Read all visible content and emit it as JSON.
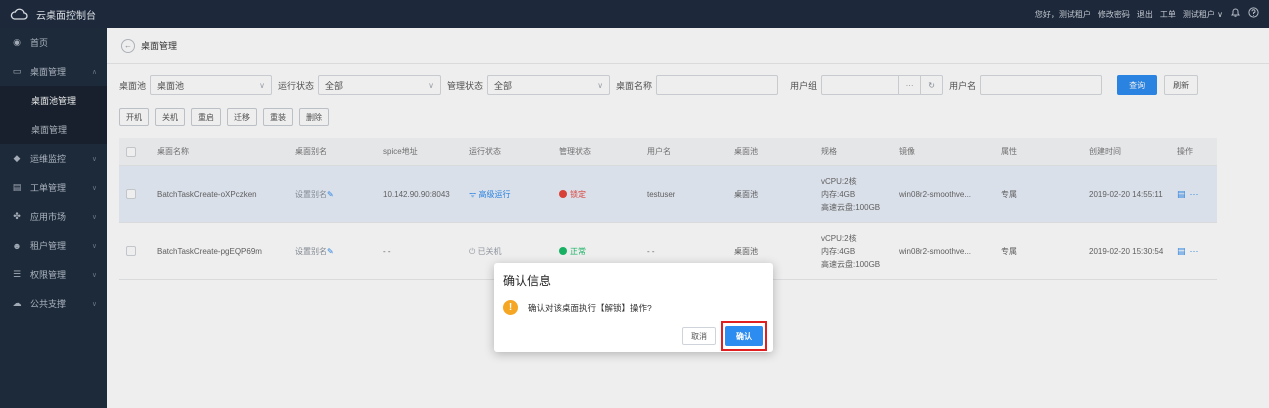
{
  "app": {
    "title": "云桌面控制台"
  },
  "topbar": {
    "greeting": "您好，测试租户",
    "change_password": "修改密码",
    "logout": "退出",
    "ticket": "工单",
    "tenant": "测试租户",
    "tenant_caret": "∨",
    "bell_icon": "bell-icon",
    "help_icon": "help-icon"
  },
  "sidebar": {
    "items": [
      {
        "label": "首页",
        "icon": "dashboard-icon"
      },
      {
        "label": "桌面管理",
        "icon": "monitor-icon",
        "expanded": true,
        "children": [
          {
            "label": "桌面池管理",
            "active": true
          },
          {
            "label": "桌面管理",
            "active": false
          }
        ]
      },
      {
        "label": "运维监控",
        "icon": "shield-icon"
      },
      {
        "label": "工单管理",
        "icon": "ticket-icon"
      },
      {
        "label": "应用市场",
        "icon": "apps-icon"
      },
      {
        "label": "租户管理",
        "icon": "users-icon"
      },
      {
        "label": "权限管理",
        "icon": "sliders-icon"
      },
      {
        "label": "公共支撑",
        "icon": "cloud-icon"
      }
    ]
  },
  "page": {
    "title": "桌面管理"
  },
  "filters": {
    "pool_label": "桌面池",
    "pool_value": "桌面池",
    "run_label": "运行状态",
    "run_value": "全部",
    "mgmt_label": "管理状态",
    "mgmt_value": "全部",
    "name_label": "桌面名称",
    "group_label": "用户组",
    "group_more": "···",
    "user_label": "用户名",
    "query": "查询",
    "refresh": "刷新"
  },
  "actions": [
    "开机",
    "关机",
    "重启",
    "迁移",
    "重装",
    "删除"
  ],
  "table": {
    "headers": [
      "桌面名称",
      "桌面别名",
      "spice地址",
      "运行状态",
      "管理状态",
      "用户名",
      "桌面池",
      "规格",
      "镜像",
      "属性",
      "创建时间",
      "操作"
    ],
    "rows": [
      {
        "name": "BatchTaskCreate-oXPczken",
        "alias": "设置别名",
        "spice": "10.142.90.90:8043",
        "run_status": "高级运行",
        "mgmt_status": "锁定",
        "user": "testuser",
        "pool": "桌面池",
        "spec": [
          "vCPU:2核",
          "内存:4GB",
          "高速云盘:100GB"
        ],
        "image": "win08r2-smoothve...",
        "attr": "专属",
        "created": "2019-02-20 14:55:11",
        "selected": true
      },
      {
        "name": "BatchTaskCreate-pgEQP69m",
        "alias": "设置别名",
        "spice": "- -",
        "run_status": "已关机",
        "mgmt_status": "正常",
        "user": "- -",
        "pool": "桌面池",
        "spec": [
          "vCPU:2核",
          "内存:4GB",
          "高速云盘:100GB"
        ],
        "image": "win08r2-smoothve...",
        "attr": "专属",
        "created": "2019-02-20 15:30:54",
        "selected": false
      }
    ]
  },
  "dialog": {
    "title": "确认信息",
    "message": "确认对该桌面执行【解锁】操作?",
    "cancel": "取消",
    "confirm": "确认"
  },
  "colors": {
    "primary": "#2d8cf0",
    "sidebar": "#1f2d3d",
    "danger": "#e8453c",
    "success": "#19be6b",
    "warning": "#f5a623",
    "highlight_border": "#e02020"
  }
}
